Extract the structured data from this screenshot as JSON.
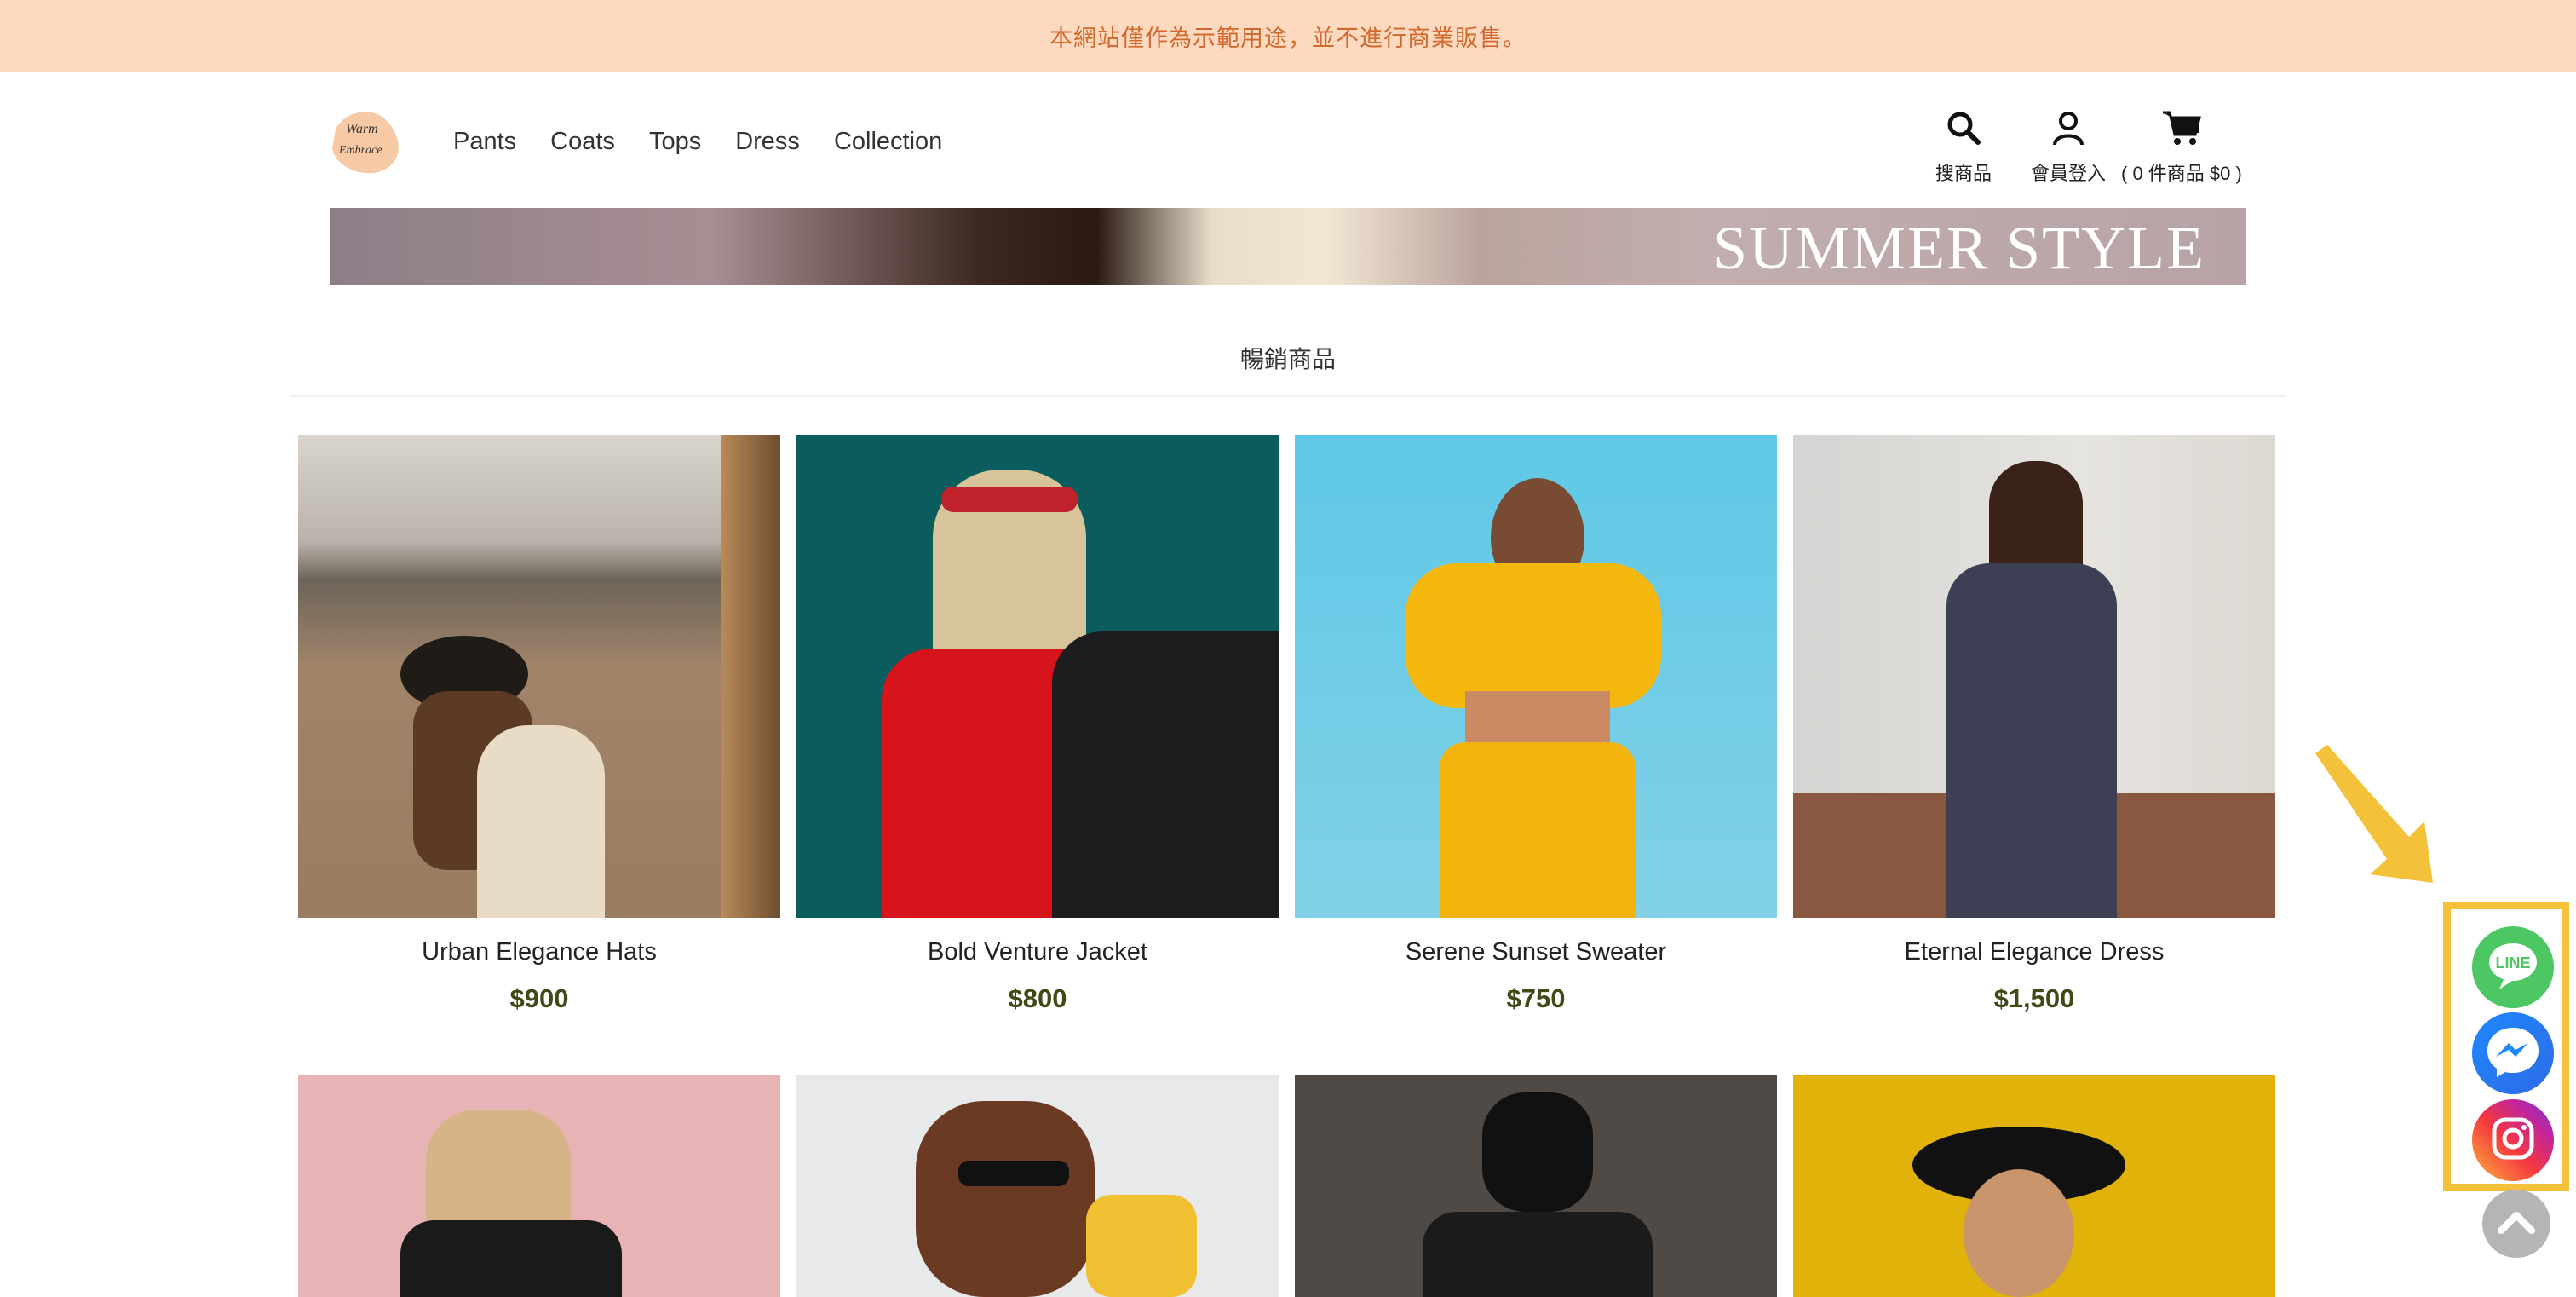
{
  "announcement": "本網站僅作為示範用途，並不進行商業販售。",
  "logo": {
    "alt": "Warm Embrace"
  },
  "nav": [
    "Pants",
    "Coats",
    "Tops",
    "Dress",
    "Collection"
  ],
  "header_tools": {
    "search_label": "搜商品",
    "account_label": "會員登入",
    "cart_label": "( 0 件商品 $0 )"
  },
  "banner": {
    "text": "SUMMER STYLE"
  },
  "section": {
    "title": "暢銷商品"
  },
  "products": [
    {
      "name": "Urban Elegance Hats",
      "price": "$900"
    },
    {
      "name": "Bold Venture Jacket",
      "price": "$800"
    },
    {
      "name": "Serene Sunset Sweater",
      "price": "$750"
    },
    {
      "name": "Eternal Elegance Dress",
      "price": "$1,500"
    }
  ],
  "social": [
    "line-icon",
    "messenger-icon",
    "instagram-icon"
  ],
  "colors": {
    "announce_bg": "#fdd9c0",
    "announce_text": "#d2682c",
    "price": "#3f4a17",
    "highlight": "#f4c13a",
    "line": "#4cc764",
    "messenger": "#1e88ff"
  }
}
